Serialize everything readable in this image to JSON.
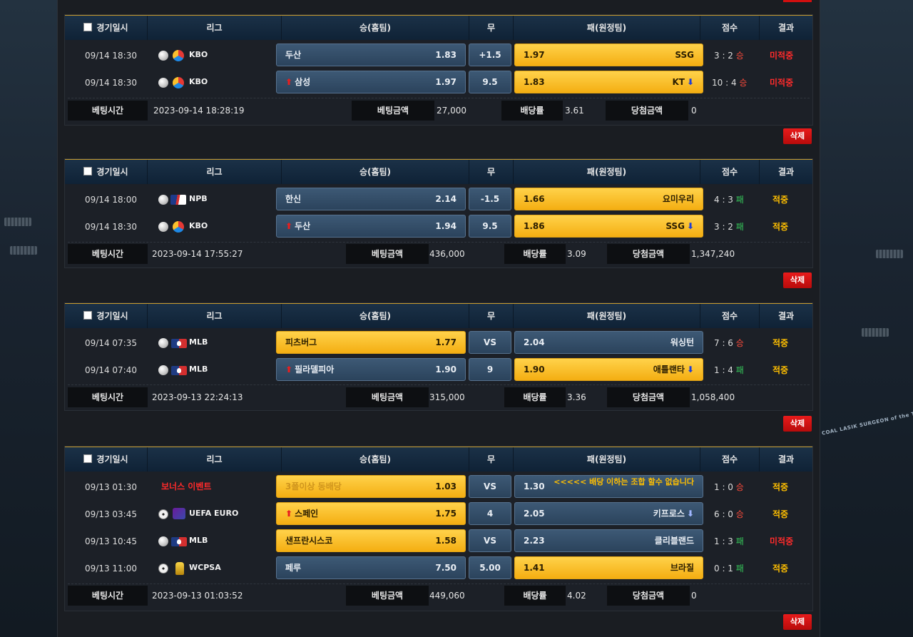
{
  "headers": {
    "date": "경기일시",
    "league": "리그",
    "home": "승(홈팀)",
    "draw": "무",
    "away": "패(원정팀)",
    "score": "점수",
    "result": "결과"
  },
  "summary_labels": {
    "bet_time": "베팅시간",
    "bet_amount": "베팅금액",
    "odds": "배당률",
    "win_amount": "당첨금액"
  },
  "delete_label": "삭제",
  "slips": [
    {
      "games": [
        {
          "date": "09/14 18:30",
          "league": "KBO",
          "home": "두산",
          "home_odds": "1.83",
          "draw": "+1.5",
          "away_odds": "1.97",
          "away": "SSG",
          "score_text": "3 : 2",
          "score_tag": "승",
          "result": "미적중"
        },
        {
          "date": "09/14 18:30",
          "league": "KBO",
          "home": "삼성",
          "home_odds": "1.97",
          "draw": "9.5",
          "away_odds": "1.83",
          "away": "KT",
          "score_text": "10 : 4",
          "score_tag": "승",
          "result": "미적중"
        }
      ],
      "summary": {
        "bet_time": "2023-09-14 18:28:19",
        "bet_amount": "27,000",
        "odds": "3.61",
        "win_amount": "0"
      }
    },
    {
      "games": [
        {
          "date": "09/14 18:00",
          "league": "NPB",
          "home": "한신",
          "home_odds": "2.14",
          "draw": "-1.5",
          "away_odds": "1.66",
          "away": "요미우리",
          "score_text": "4 : 3",
          "score_tag": "패",
          "result": "적중"
        },
        {
          "date": "09/14 18:30",
          "league": "KBO",
          "home": "두산",
          "home_odds": "1.94",
          "draw": "9.5",
          "away_odds": "1.86",
          "away": "SSG",
          "score_text": "3 : 2",
          "score_tag": "패",
          "result": "적중"
        }
      ],
      "summary": {
        "bet_time": "2023-09-14 17:55:27",
        "bet_amount": "436,000",
        "odds": "3.09",
        "win_amount": "1,347,240"
      }
    },
    {
      "games": [
        {
          "date": "09/14 07:35",
          "league": "MLB",
          "home": "피츠버그",
          "home_odds": "1.77",
          "draw": "VS",
          "away_odds": "2.04",
          "away": "워싱턴",
          "score_text": "7 : 6",
          "score_tag": "승",
          "result": "적중"
        },
        {
          "date": "09/14 07:40",
          "league": "MLB",
          "home": "필라델피아",
          "home_odds": "1.90",
          "draw": "9",
          "away_odds": "1.90",
          "away": "애틀랜타",
          "score_text": "1 : 4",
          "score_tag": "패",
          "result": "적중"
        }
      ],
      "summary": {
        "bet_time": "2023-09-13 22:24:13",
        "bet_amount": "315,000",
        "odds": "3.36",
        "win_amount": "1,058,400"
      }
    },
    {
      "games": [
        {
          "date": "09/13 01:30",
          "league": "보너스 이벤트",
          "home": "3폴이상 동배당",
          "home_odds": "1.03",
          "draw": "VS",
          "away_odds": "1.30",
          "away": "<<<<< 배당 이하는 조합 할수 없습니다",
          "score_text": "1 : 0",
          "score_tag": "승",
          "result": "적중"
        },
        {
          "date": "09/13 03:45",
          "league": "UEFA EURO",
          "home": "스페인",
          "home_odds": "1.75",
          "draw": "4",
          "away_odds": "2.05",
          "away": "키프로스",
          "score_text": "6 : 0",
          "score_tag": "승",
          "result": "적중"
        },
        {
          "date": "09/13 10:45",
          "league": "MLB",
          "home": "샌프란시스코",
          "home_odds": "1.58",
          "draw": "VS",
          "away_odds": "2.23",
          "away": "클리블랜드",
          "score_text": "1 : 3",
          "score_tag": "패",
          "result": "미적중"
        },
        {
          "date": "09/13 11:00",
          "league": "WCPSA",
          "home": "페루",
          "home_odds": "7.50",
          "draw": "5.00",
          "away_odds": "1.41",
          "away": "브라질",
          "score_text": "0 : 1",
          "score_tag": "패",
          "result": "적중"
        }
      ],
      "summary": {
        "bet_time": "2023-09-13 01:03:52",
        "bet_amount": "449,060",
        "odds": "4.02",
        "win_amount": "0"
      }
    }
  ],
  "side_caption": "COAL LASIK SURGEON of the TEXAS RANGERS",
  "colors": {
    "gold": "#f4ae12",
    "blue": "#2b435c",
    "win": "#ff4a3a",
    "loss": "#36c95a",
    "miss": "#ff2b2b",
    "hit": "#ffbf00",
    "delete": "#d10f0f"
  }
}
